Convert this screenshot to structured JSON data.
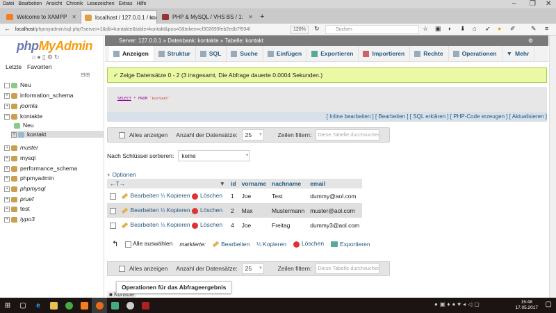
{
  "browser": {
    "menu": [
      "Datei",
      "Bearbeiten",
      "Ansicht",
      "Chronik",
      "Lesezeichen",
      "Extras",
      "Hilfe"
    ],
    "tabs": [
      {
        "title": "Welcome to XAMPP"
      },
      {
        "title": "localhost / 127.0.0.1 / konta"
      },
      {
        "title": "PHP & MySQL / VHS BS / 1:"
      }
    ],
    "url_host": "localhost",
    "url_path": "/phpmyadmin/sql.php?server=1&db=kontakte&table=kontakt&pos=0&token=cf302693feb2edb7f934l",
    "zoom": "120%",
    "search_placeholder": "Suchen"
  },
  "sidebar": {
    "logo": {
      "php": "php",
      "myadmin": "MyAdmin"
    },
    "recent": "Letzte",
    "favorites": "Favoriten",
    "tree": [
      {
        "label": "Neu"
      },
      {
        "label": "information_schema"
      },
      {
        "label": "joomla"
      },
      {
        "label": "kontakte"
      },
      {
        "label": "Neu"
      },
      {
        "label": "kontakt"
      },
      {
        "label": "muster"
      },
      {
        "label": "mysql"
      },
      {
        "label": "performance_schema"
      },
      {
        "label": "phpmyadmin"
      },
      {
        "label": "phpmysql"
      },
      {
        "label": "pruef"
      },
      {
        "label": "test"
      },
      {
        "label": "typo3"
      }
    ]
  },
  "main": {
    "breadcrumb": {
      "server": "Server: 127.0.0.1",
      "db": "Datenbank: kontakte",
      "table": "Tabelle: kontakt"
    },
    "tabs": [
      "Anzeigen",
      "Struktur",
      "SQL",
      "Suche",
      "Einfügen",
      "Exportieren",
      "Importieren",
      "Rechte",
      "Operationen",
      "Mehr"
    ],
    "success": "Zeige Datensätze 0 - 2 (3 insgesamt, Die Abfrage dauerte 0.0004 Sekunden.)",
    "sql": {
      "select": "SELECT",
      "star": "*",
      "from": "FROM",
      "table": "`kontakt`"
    },
    "links": [
      "Inline bearbeiten",
      "Bearbeiten",
      "SQL erklären",
      "PHP-Code erzeugen",
      "Aktualisieren"
    ],
    "nav": {
      "show_all": "Alles anzeigen",
      "rows_label": "Anzahl der Datensätze:",
      "rows_value": "25",
      "filter_label": "Zeilen filtern:",
      "filter_placeholder": "Diese Tabelle durchsuchen"
    },
    "sort": {
      "label": "Nach Schlüssel sortieren:",
      "value": "keine"
    },
    "options": "+ Optionen",
    "table": {
      "arrows": "←T→",
      "columns": [
        "id",
        "vorname",
        "nachname",
        "email"
      ],
      "actions": {
        "edit": "Bearbeiten",
        "copy": "Kopieren",
        "delete": "Löschen"
      },
      "rows": [
        [
          "1",
          "Joe",
          "Test",
          "dummy@aol.com"
        ],
        [
          "2",
          "Max",
          "Mustermann",
          "muster@aol.com"
        ],
        [
          "4",
          "Joe",
          "Freitag",
          "dummy3@aol.com"
        ]
      ]
    },
    "bulk": {
      "select_all": "Alle auswählen",
      "marked": "markierte:",
      "edit": "Bearbeiten",
      "copy": "Kopieren",
      "delete": "Löschen",
      "export": "Exportieren"
    },
    "operations": "Operationen für das Abfrageergebnis",
    "console": "Konsole"
  },
  "taskbar": {
    "time": "15:48",
    "date": "17.05.2017"
  }
}
